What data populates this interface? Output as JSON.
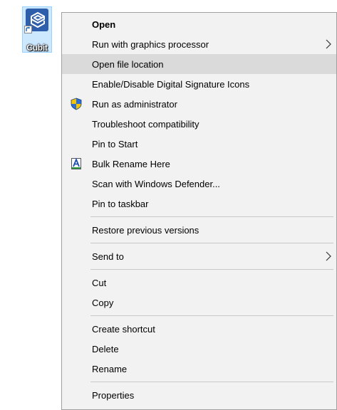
{
  "desktop_icon": {
    "label": "Cubit",
    "selected": true,
    "icon": "cubit-app-icon",
    "shortcut_overlay_icon": "shortcut-arrow-icon"
  },
  "context_menu": {
    "groups": [
      [
        {
          "label": "Open",
          "bold": true
        },
        {
          "label": "Run with graphics processor",
          "submenu": true
        },
        {
          "label": "Open file location",
          "highlighted": true
        },
        {
          "label": "Enable/Disable Digital Signature Icons"
        },
        {
          "label": "Run as administrator",
          "icon": "uac-shield-icon"
        },
        {
          "label": "Troubleshoot compatibility"
        },
        {
          "label": "Pin to Start"
        },
        {
          "label": "Bulk Rename Here",
          "icon": "bulk-rename-icon"
        },
        {
          "label": "Scan with Windows Defender..."
        },
        {
          "label": "Pin to taskbar"
        }
      ],
      [
        {
          "label": "Restore previous versions"
        }
      ],
      [
        {
          "label": "Send to",
          "submenu": true
        }
      ],
      [
        {
          "label": "Cut"
        },
        {
          "label": "Copy"
        }
      ],
      [
        {
          "label": "Create shortcut"
        },
        {
          "label": "Delete"
        },
        {
          "label": "Rename"
        }
      ],
      [
        {
          "label": "Properties"
        }
      ]
    ]
  },
  "colors": {
    "menu_background": "#f2f2f2",
    "menu_border": "#a0a0a0",
    "highlight": "#dadada",
    "separator": "#c8c8c8",
    "icon_selection": "#cce8ff"
  }
}
